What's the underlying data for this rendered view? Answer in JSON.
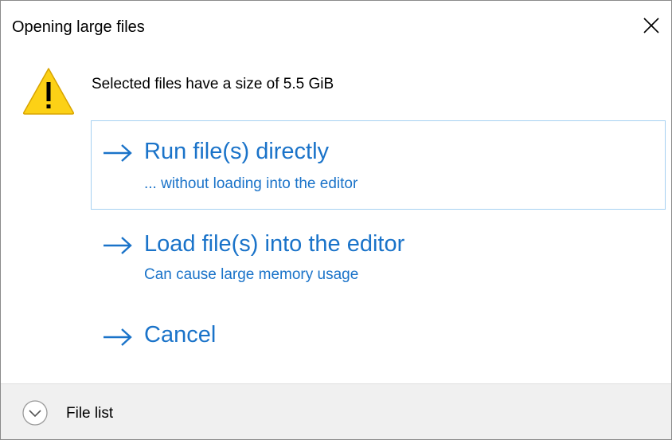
{
  "window": {
    "title": "Opening large files"
  },
  "message": "Selected files have a size of 5.5 GiB",
  "options": [
    {
      "main": "Run file(s) directly",
      "sub": "... without loading into the editor"
    },
    {
      "main": "Load file(s) into the editor",
      "sub": "Can cause large memory usage"
    },
    {
      "main": "Cancel"
    }
  ],
  "footer": {
    "label": "File list"
  },
  "colors": {
    "link": "#1a73c9",
    "hover_border": "#a6d1f1",
    "warning_fill": "#fcd116",
    "footer_bg": "#f0f0f0"
  },
  "icons": {
    "warning": "warning-icon",
    "close": "close-icon",
    "arrow": "arrow-right-icon",
    "expander": "chevron-down-icon"
  }
}
